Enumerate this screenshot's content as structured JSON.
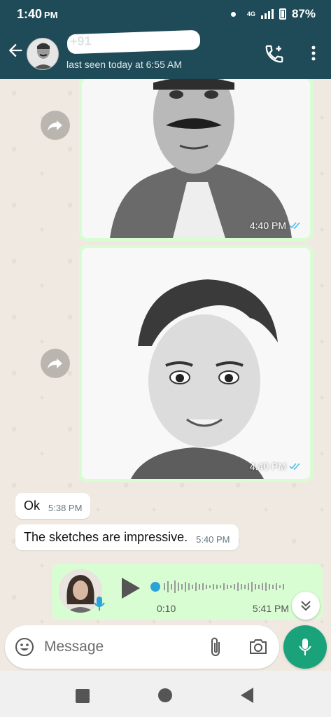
{
  "status": {
    "time": "1:40",
    "ampm": "PM",
    "network": "4G",
    "battery": "87%"
  },
  "header": {
    "contact_name": "+91",
    "last_seen": "last seen today at 6:55 AM"
  },
  "messages": {
    "image1_time": "4:40 PM",
    "image2_time": "4:40 PM",
    "msg1": {
      "text": "Ok",
      "time": "5:38 PM"
    },
    "msg2": {
      "text": "The sketches are impressive.",
      "time": "5:40 PM"
    },
    "voice": {
      "duration": "0:10",
      "time": "5:41 PM"
    }
  },
  "composer": {
    "placeholder": "Message"
  },
  "colors": {
    "header": "#1f4a57",
    "outgoing": "#d9fdd3",
    "incoming": "#ffffff",
    "mic": "#1aa37a",
    "ticks": "#53bdeb"
  }
}
